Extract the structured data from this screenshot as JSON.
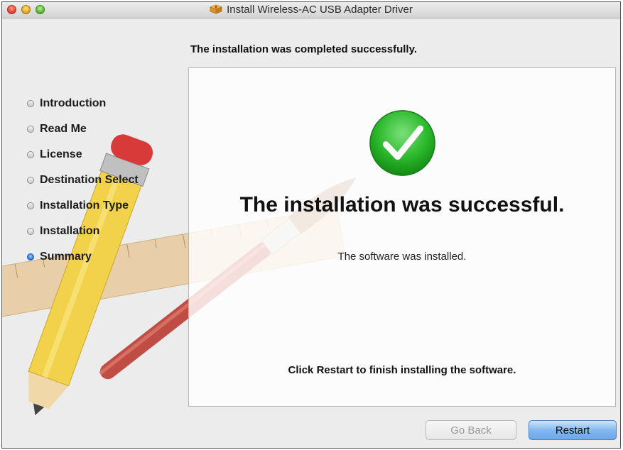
{
  "window": {
    "title": "Install Wireless-AC USB Adapter Driver"
  },
  "header": {
    "status": "The installation was completed successfully."
  },
  "sidebar": {
    "steps": [
      {
        "label": "Introduction",
        "active": false
      },
      {
        "label": "Read Me",
        "active": false
      },
      {
        "label": "License",
        "active": false
      },
      {
        "label": "Destination Select",
        "active": false
      },
      {
        "label": "Installation Type",
        "active": false
      },
      {
        "label": "Installation",
        "active": false
      },
      {
        "label": "Summary",
        "active": true
      }
    ]
  },
  "main": {
    "result_title": "The installation was successful.",
    "result_detail": "The software was installed.",
    "instruction": "Click Restart to finish installing the software."
  },
  "buttons": {
    "back_label": "Go Back",
    "back_enabled": false,
    "restart_label": "Restart"
  },
  "colors": {
    "check_green": "#2bb82b",
    "default_button": "#6aa6ea"
  },
  "icons": [
    "package-icon",
    "checkmark-icon",
    "pencil-ruler-brush-artwork"
  ]
}
